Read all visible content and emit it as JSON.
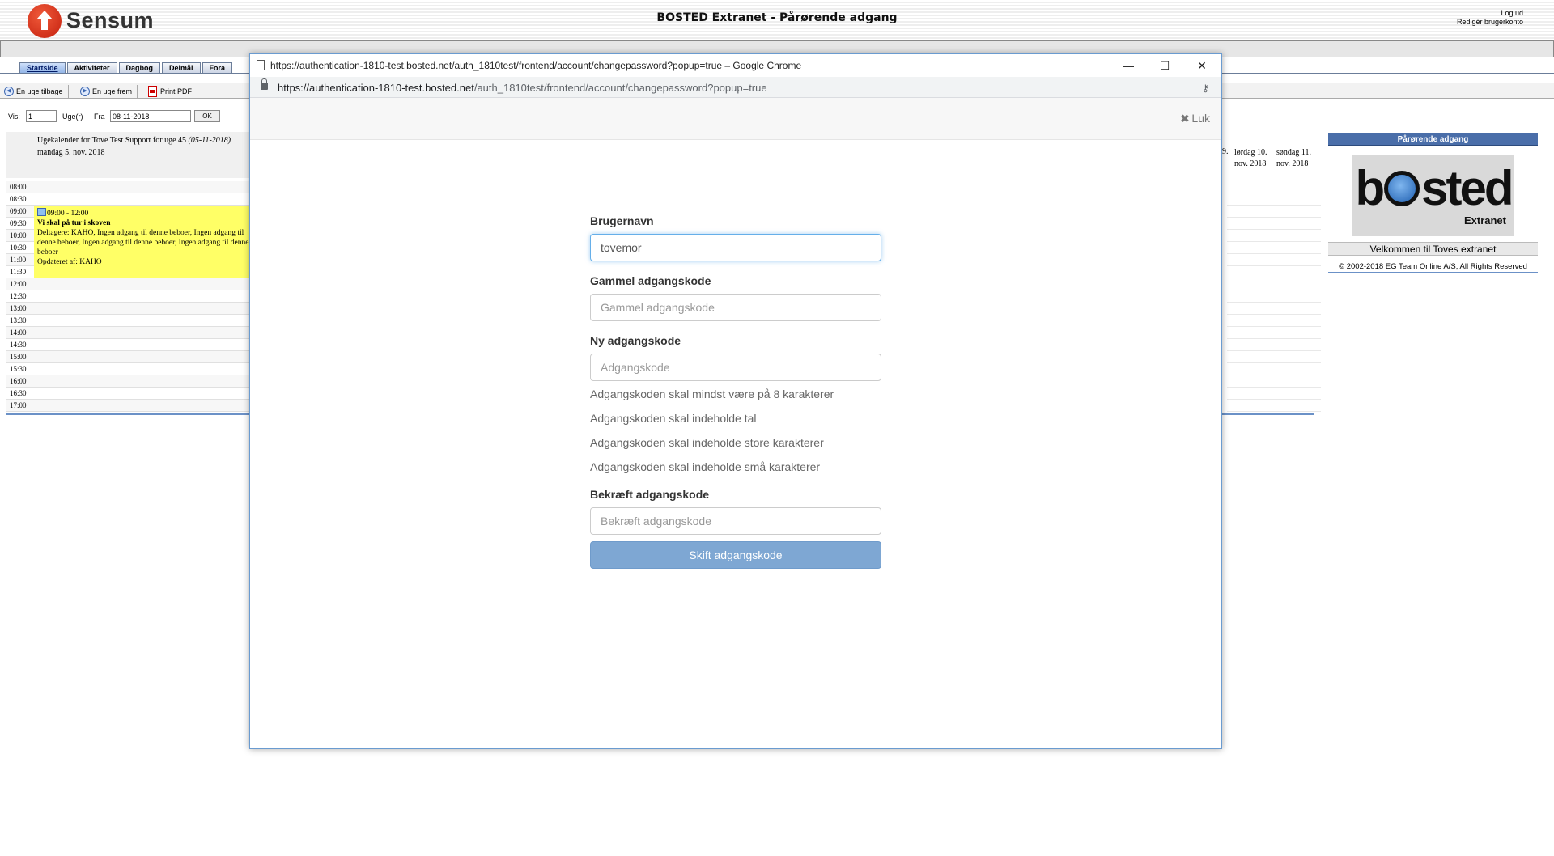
{
  "app": {
    "brand": "Sensum",
    "title": "BOSTED Extranet - Pårørende adgang",
    "logout": "Log ud",
    "edit_account": "Redigér brugerkonto"
  },
  "tabs": [
    "Startside",
    "Aktiviteter",
    "Dagbog",
    "Delmål",
    "Fora"
  ],
  "toolbar": {
    "prev_week": "En uge tilbage",
    "next_week": "En uge frem",
    "print_pdf": "Print PDF"
  },
  "filter": {
    "show_label": "Vis:",
    "show_value": "1",
    "weeks_label": "Uge(r)",
    "from_label": "Fra",
    "from_value": "08-11-2018",
    "ok_label": "OK"
  },
  "calendar": {
    "week_title": "Ugekalender for Tove Test Support for uge 45",
    "week_date": "(05-11-2018)",
    "monday_head": "mandag 5. nov. 2018",
    "friday_frag": "9.",
    "saturday_head": "lørdag 10. nov. 2018",
    "sunday_head": "søndag 11. nov. 2018",
    "times": [
      "08:00",
      "08:30",
      "09:00",
      "09:30",
      "10:00",
      "10:30",
      "11:00",
      "11:30",
      "12:00",
      "12:30",
      "13:00",
      "13:30",
      "14:00",
      "14:30",
      "15:00",
      "15:30",
      "16:00",
      "16:30",
      "17:00"
    ],
    "event": {
      "time": "09:00 - 12:00",
      "title": "Vi skal på tur i skoven",
      "participants": "Deltagere: KAHO, Ingen adgang til denne beboer, Ingen adgang til denne beboer, Ingen adgang til denne beboer, Ingen adgang til denne beboer",
      "updated": "Opdateret af: KAHO"
    }
  },
  "side_panel": {
    "header": "Pårørende adgang",
    "logo_b": "b",
    "logo_rest": "sted",
    "logo_sub": "Extranet",
    "welcome": "Velkommen til Toves extranet",
    "copyright": "© 2002-2018 EG Team Online A/S, All Rights Reserved"
  },
  "popup": {
    "window_title": "https://authentication-1810-test.bosted.net/auth_1810test/frontend/account/changepassword?popup=true – Google Chrome",
    "url_host": "https://authentication-1810-test.bosted.net",
    "url_path": "/auth_1810test/frontend/account/changepassword?popup=true",
    "minimize": "—",
    "maximize": "☐",
    "close": "✕",
    "close_modal_icon": "✖",
    "close_modal_label": "Luk",
    "form": {
      "username_label": "Brugernavn",
      "username_value": "tovemor",
      "old_password_label": "Gammel adgangskode",
      "old_password_placeholder": "Gammel adgangskode",
      "new_password_label": "Ny adgangskode",
      "new_password_placeholder": "Adgangskode",
      "hints": [
        "Adgangskoden skal mindst være på 8 karakterer",
        "Adgangskoden skal indeholde tal",
        "Adgangskoden skal indeholde store karakterer",
        "Adgangskoden skal indeholde små karakterer"
      ],
      "confirm_label": "Bekræft adgangskode",
      "confirm_placeholder": "Bekræft adgangskode",
      "submit": "Skift adgangskode"
    }
  },
  "colors": {
    "accent_blue": "#4a6ea9",
    "event_yellow": "#ffff66",
    "submit_button": "#7ea7d3",
    "focus_border": "#66afe9"
  },
  "icons": [
    "home-up-arrow-icon",
    "prev-circle-icon",
    "next-circle-icon",
    "pdf-icon",
    "page-icon",
    "lock-icon",
    "key-icon",
    "close-icon",
    "event-home-icon"
  ]
}
